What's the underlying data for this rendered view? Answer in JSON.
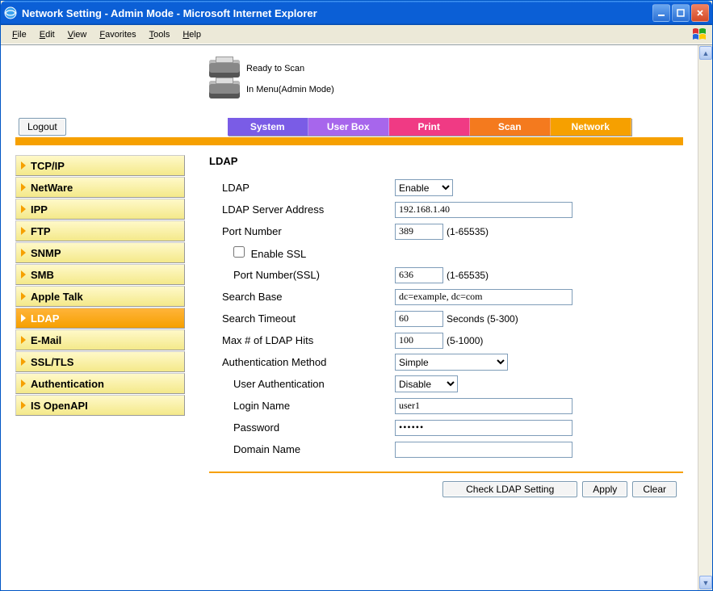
{
  "window": {
    "title": "Network Setting - Admin Mode - Microsoft Internet Explorer"
  },
  "menus": [
    "File",
    "Edit",
    "View",
    "Favorites",
    "Tools",
    "Help"
  ],
  "status": {
    "line1": "Ready to Scan",
    "line2": "In Menu(Admin Mode)"
  },
  "logout_label": "Logout",
  "tabs": {
    "system": "System",
    "userbox": "User Box",
    "print": "Print",
    "scan": "Scan",
    "network": "Network"
  },
  "sidebar": {
    "items": [
      {
        "label": "TCP/IP"
      },
      {
        "label": "NetWare"
      },
      {
        "label": "IPP"
      },
      {
        "label": "FTP"
      },
      {
        "label": "SNMP"
      },
      {
        "label": "SMB"
      },
      {
        "label": "Apple Talk"
      },
      {
        "label": "LDAP"
      },
      {
        "label": "E-Mail"
      },
      {
        "label": "SSL/TLS"
      },
      {
        "label": "Authentication"
      },
      {
        "label": "IS OpenAPI"
      }
    ]
  },
  "form": {
    "section_title": "LDAP",
    "ldap_label": "LDAP",
    "ldap_value": "Enable",
    "server_label": "LDAP Server Address",
    "server_value": "192.168.1.40",
    "port_label": "Port Number",
    "port_value": "389",
    "port_note": "(1-65535)",
    "enable_ssl_label": "Enable SSL",
    "port_ssl_label": "Port Number(SSL)",
    "port_ssl_value": "636",
    "port_ssl_note": "(1-65535)",
    "search_base_label": "Search Base",
    "search_base_value": "dc=example, dc=com",
    "timeout_label": "Search Timeout",
    "timeout_value": "60",
    "timeout_note": "Seconds (5-300)",
    "maxhits_label": "Max # of LDAP Hits",
    "maxhits_value": "100",
    "maxhits_note": "(5-1000)",
    "authmethod_label": "Authentication Method",
    "authmethod_value": "Simple",
    "userauth_label": "User Authentication",
    "userauth_value": "Disable",
    "login_label": "Login Name",
    "login_value": "user1",
    "password_label": "Password",
    "password_value": "••••••",
    "domain_label": "Domain Name",
    "domain_value": ""
  },
  "buttons": {
    "check": "Check LDAP Setting",
    "apply": "Apply",
    "clear": "Clear"
  }
}
